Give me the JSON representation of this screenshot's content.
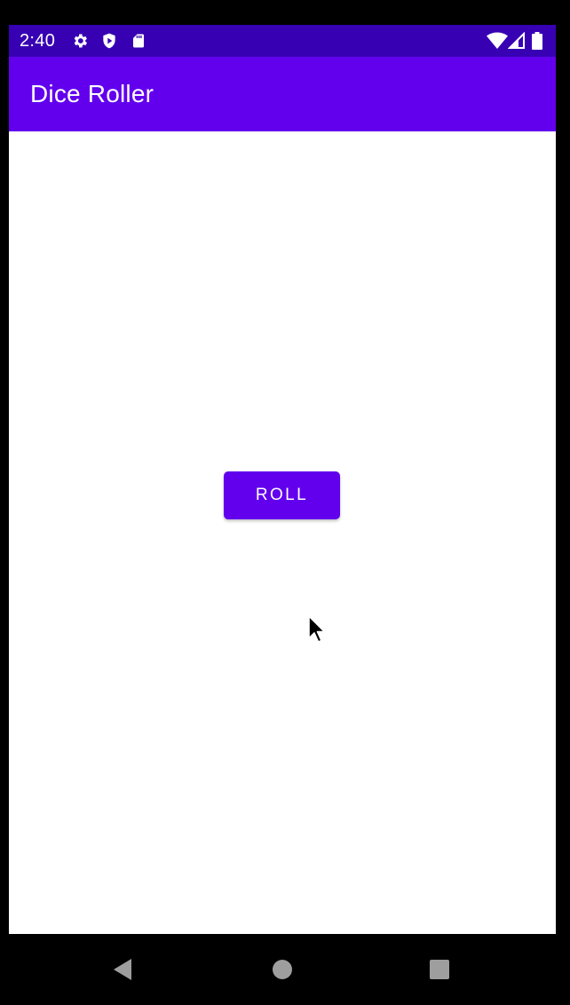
{
  "status_bar": {
    "time": "2:40",
    "icons": [
      "gear-icon",
      "shield-play-icon",
      "sd-card-icon",
      "wifi-icon",
      "cell-signal-icon",
      "battery-icon"
    ]
  },
  "app_bar": {
    "title": "Dice Roller"
  },
  "main": {
    "roll_button_label": "ROLL"
  },
  "nav_bar": {
    "icons": [
      "back-icon",
      "home-icon",
      "recents-icon"
    ]
  },
  "colors": {
    "primary": "#6200ee",
    "primary_dark": "#3700b3",
    "background": "#ffffff",
    "on_primary": "#ffffff"
  }
}
